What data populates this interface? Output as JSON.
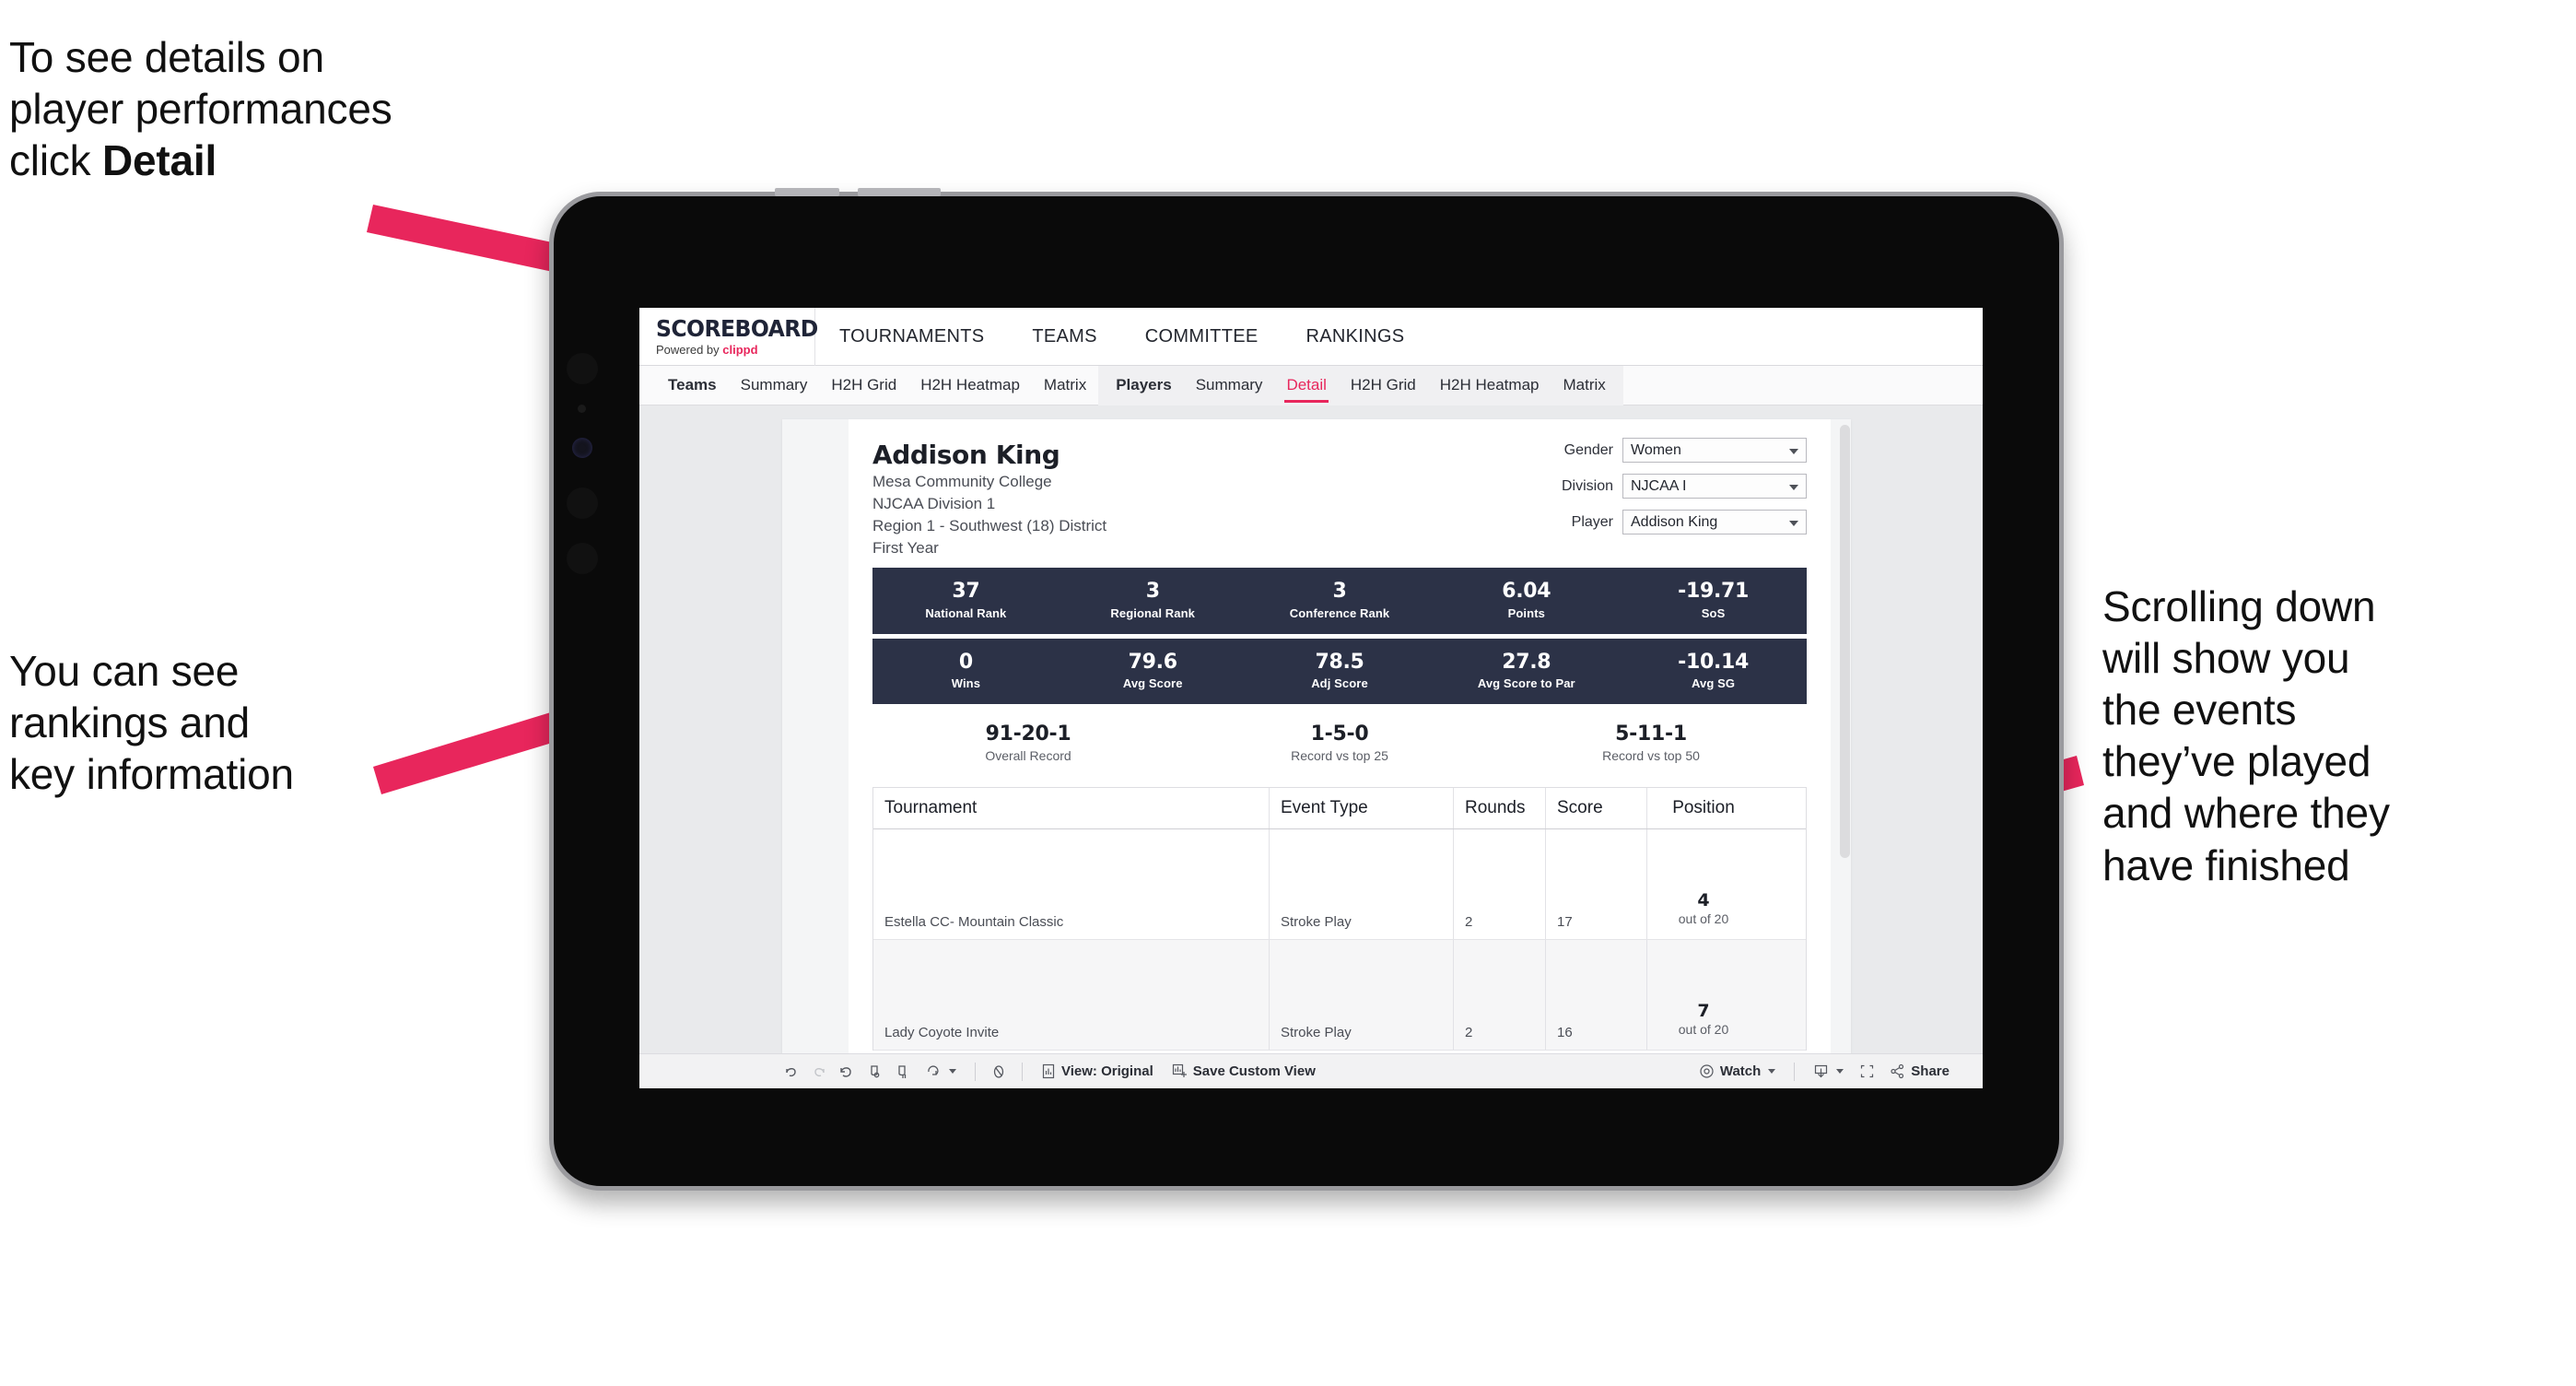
{
  "annotations": {
    "detail": {
      "text_before": "To see details on\nplayer performances\nclick ",
      "bold": "Detail"
    },
    "rankings": {
      "text": "You can see\nrankings and\nkey information"
    },
    "scrolling": {
      "text": "Scrolling down\nwill show you\nthe events\nthey’ve played\nand where they\nhave finished"
    }
  },
  "app": {
    "logo": {
      "word": "SCOREBOARD",
      "powered_prefix": "Powered by ",
      "brand": "clippd"
    },
    "top_nav": [
      "TOURNAMENTS",
      "TEAMS",
      "COMMITTEE",
      "RANKINGS"
    ],
    "sub_nav_teams": [
      "Teams",
      "Summary",
      "H2H Grid",
      "H2H Heatmap",
      "Matrix"
    ],
    "sub_nav_players": [
      "Players",
      "Summary",
      "Detail",
      "H2H Grid",
      "H2H Heatmap",
      "Matrix"
    ],
    "sub_nav_active": "Detail"
  },
  "player": {
    "name": "Addison King",
    "school": "Mesa Community College",
    "division": "NJCAA Division 1",
    "region": "Region 1 - Southwest (18) District",
    "year": "First Year"
  },
  "filters": [
    {
      "label": "Gender",
      "value": "Women"
    },
    {
      "label": "Division",
      "value": "NJCAA I"
    },
    {
      "label": "Player",
      "value": "Addison King"
    }
  ],
  "stats_row_1": [
    {
      "value": "37",
      "label": "National Rank"
    },
    {
      "value": "3",
      "label": "Regional Rank"
    },
    {
      "value": "3",
      "label": "Conference Rank"
    },
    {
      "value": "6.04",
      "label": "Points"
    },
    {
      "value": "-19.71",
      "label": "SoS"
    }
  ],
  "stats_row_2": [
    {
      "value": "0",
      "label": "Wins"
    },
    {
      "value": "79.6",
      "label": "Avg Score"
    },
    {
      "value": "78.5",
      "label": "Adj Score"
    },
    {
      "value": "27.8",
      "label": "Avg Score to Par"
    },
    {
      "value": "-10.14",
      "label": "Avg SG"
    }
  ],
  "records": [
    {
      "value": "91-20-1",
      "label": "Overall Record"
    },
    {
      "value": "1-5-0",
      "label": "Record vs top 25"
    },
    {
      "value": "5-11-1",
      "label": "Record vs top 50"
    }
  ],
  "table": {
    "columns": [
      "Tournament",
      "Event Type",
      "Rounds",
      "Score",
      "Position"
    ],
    "rows": [
      {
        "tournament": "Estella CC- Mountain Classic",
        "event_type": "Stroke Play",
        "rounds": "2",
        "score": "17",
        "position": "4",
        "position_suffix": "out of 20"
      },
      {
        "tournament": "Lady Coyote Invite",
        "event_type": "Stroke Play",
        "rounds": "2",
        "score": "16",
        "position": "7",
        "position_suffix": "out of 20"
      }
    ]
  },
  "toolbar": {
    "view_label": "View: Original",
    "save_label": "Save Custom View",
    "watch_label": "Watch",
    "share_label": "Share"
  },
  "colors": {
    "accent": "#e8265c",
    "stat_bar": "#2c3247",
    "text": "#1c1f27"
  }
}
